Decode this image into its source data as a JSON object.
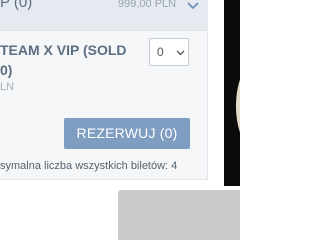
{
  "top_row": {
    "title_fragment": "P (0)",
    "price": "999,00 PLN",
    "chevron_icon": "chevron-down-icon"
  },
  "ticket": {
    "name_line1": "TEAM X VIP (SOLD",
    "name_line2": "0)",
    "price_fragment": "LN",
    "quantity_selected": "0",
    "quantity_caret_icon": "chevron-down-icon"
  },
  "reserve_button": {
    "label": "REZERWUJ (0)"
  },
  "note": {
    "max_tickets": "symalna liczba wszystkich biletów: 4"
  },
  "colors": {
    "accent_button": "#7f9cc1",
    "title_text": "#5c6e82",
    "card_background": "#f4f6f8",
    "header_background": "#e5eaf1"
  }
}
